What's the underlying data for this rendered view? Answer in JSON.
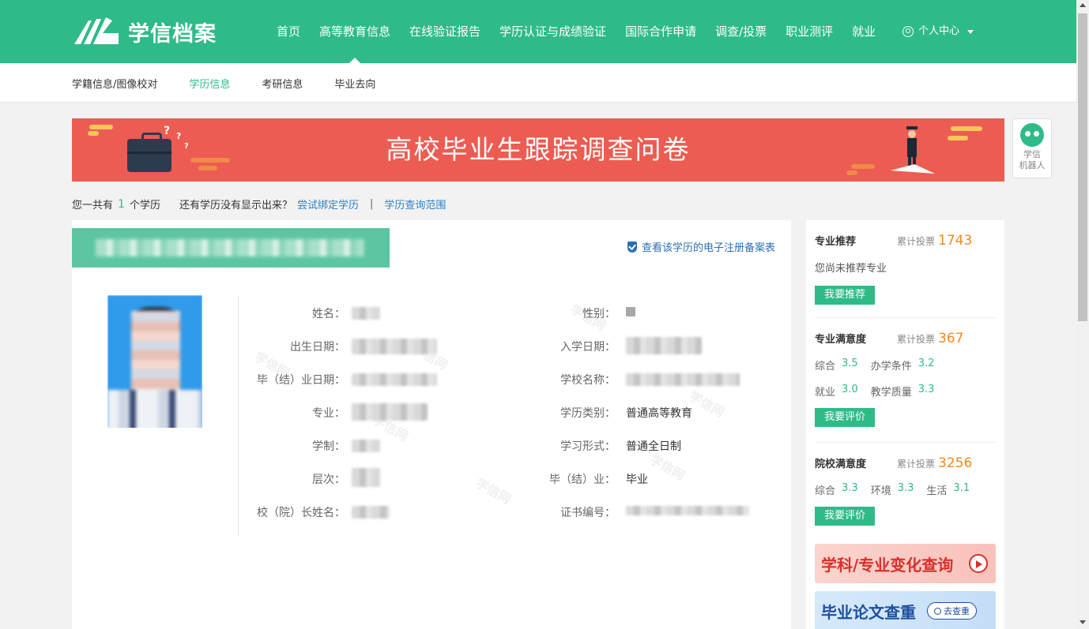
{
  "header": {
    "logo_text": "学信档案",
    "nav": [
      {
        "label": "首页"
      },
      {
        "label": "高等教育信息"
      },
      {
        "label": "在线验证报告"
      },
      {
        "label": "学历认证与成绩验证"
      },
      {
        "label": "国际合作申请"
      },
      {
        "label": "调查/投票"
      },
      {
        "label": "职业测评"
      },
      {
        "label": "就业"
      }
    ],
    "user_menu": "个人中心",
    "brand_color": "#2ebb87"
  },
  "subnav": {
    "items": [
      {
        "label": "学籍信息/图像校对"
      },
      {
        "label": "学历信息"
      },
      {
        "label": "考研信息"
      },
      {
        "label": "毕业去向"
      }
    ]
  },
  "banner": {
    "title": "高校毕业生跟踪调查问卷",
    "color": "#ec5c52"
  },
  "robot": {
    "label_line1": "学信",
    "label_line2": "机器人"
  },
  "summary": {
    "prefix": "您一共有",
    "count": "1",
    "suffix": "个学历",
    "question": "还有学历没有显示出来？",
    "bind_link": "尝试绑定学历",
    "separator": "|",
    "scope_link": "学历查询范围"
  },
  "record": {
    "registration_link": "查看该学历的电子注册备案表",
    "fields_left": [
      {
        "label": "姓名："
      },
      {
        "label": "出生日期："
      },
      {
        "label": "毕（结）业日期："
      },
      {
        "label": "专业："
      },
      {
        "label": "学制："
      },
      {
        "label": "层次："
      },
      {
        "label": "校（院）长姓名："
      }
    ],
    "fields_right": [
      {
        "label": "性别：",
        "value": ""
      },
      {
        "label": "入学日期：",
        "value": ""
      },
      {
        "label": "学校名称：",
        "value": ""
      },
      {
        "label": "学历类别：",
        "value": "普通高等教育"
      },
      {
        "label": "学习形式：",
        "value": "普通全日制"
      },
      {
        "label": "毕（结）业：",
        "value": "毕业"
      },
      {
        "label": "证书编号：",
        "value": ""
      }
    ],
    "watermark": "学信网"
  },
  "sidebar": {
    "recommend": {
      "title": "专业推荐",
      "total_label": "累计投票",
      "total": "1743",
      "text": "您尚未推荐专业",
      "button": "我要推荐"
    },
    "major_satisfaction": {
      "title": "专业满意度",
      "total_label": "累计投票",
      "total": "367",
      "scores_row1": [
        {
          "label": "综合",
          "value": "3.5"
        },
        {
          "label": "办学条件",
          "value": "3.2"
        }
      ],
      "scores_row2": [
        {
          "label": "就业",
          "value": "3.0"
        },
        {
          "label": "教学质量",
          "value": "3.3"
        }
      ],
      "button": "我要评价"
    },
    "school_satisfaction": {
      "title": "院校满意度",
      "total_label": "累计投票",
      "total": "3256",
      "scores": [
        {
          "label": "综合",
          "value": "3.3"
        },
        {
          "label": "环境",
          "value": "3.3"
        },
        {
          "label": "生活",
          "value": "3.1"
        }
      ],
      "button": "我要评价"
    },
    "promo1": "学科/专业变化查询",
    "promo2": "毕业论文查重",
    "promo2_button": "去查重"
  }
}
